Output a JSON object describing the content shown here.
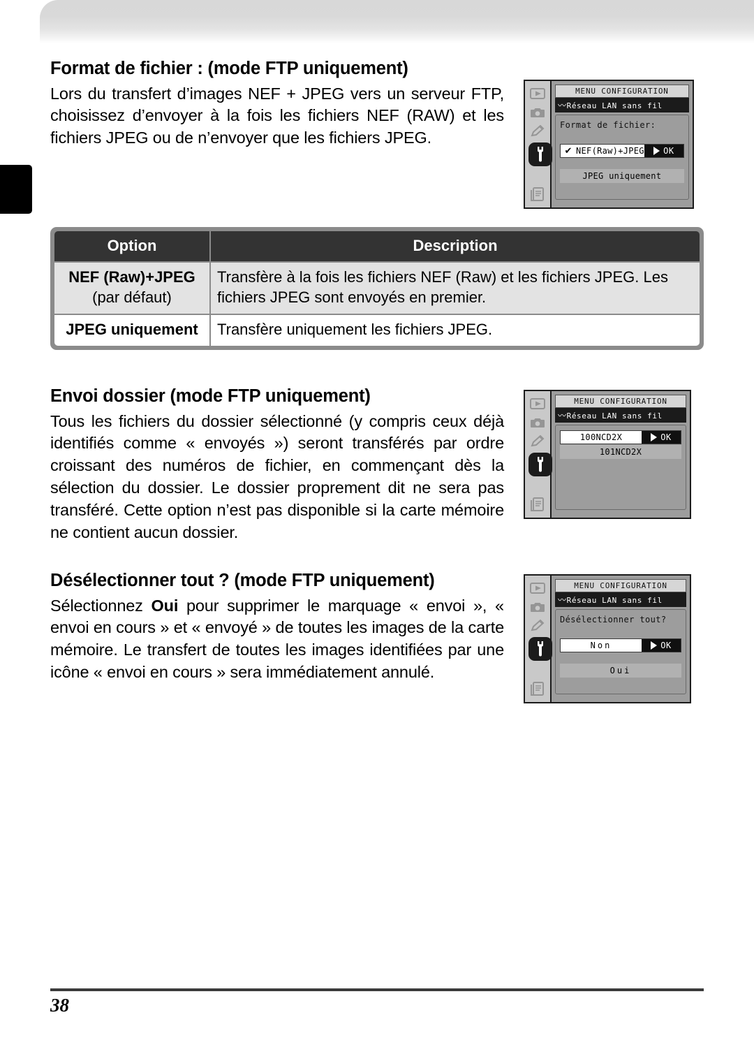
{
  "page": {
    "number": "38",
    "language": "fr"
  },
  "sections": [
    {
      "id": "format-fichier",
      "heading": "Format de fichier : (mode FTP uniquement)",
      "body": "Lors du transfert d’images NEF + JPEG vers un serveur FTP, choisissez d’envoyer à la fois les fichiers NEF (RAW) et les fichiers JPEG ou de n’envoyer que les fichiers JPEG."
    },
    {
      "id": "envoi-dossier",
      "heading": "Envoi dossier (mode FTP uniquement)",
      "body": "Tous les fichiers du dossier sélectionné (y compris ceux déjà identifiés comme « envoyés ») seront transférés par ordre croissant des numéros de fichier, en commençant dès la sélection du dossier. Le dossier proprement dit ne sera pas transféré. Cette option n’est pas disponible si la carte mémoire ne contient aucun dossier."
    },
    {
      "id": "deselectionner-tout",
      "heading": "Désélectionner tout ? (mode FTP uniquement)",
      "body_prefix": "Sélectionnez ",
      "body_bold": "Oui",
      "body_suffix": " pour supprimer le marquage « envoi », « envoi en cours » et « envoyé » de toutes les images de la carte mémoire. Le transfert de toutes les images identifiées par une icône « envoi en cours » sera immédiatement annulé."
    }
  ],
  "options_table": {
    "headers": {
      "option": "Option",
      "description": "Description"
    },
    "rows": [
      {
        "option": "NEF (Raw)+JPEG",
        "option_sub": "(par défaut)",
        "description": "Transfère à la fois les fichiers NEF (Raw) et les fichiers JPEG. Les fichiers JPEG sont envoyés en premier."
      },
      {
        "option": "JPEG uniquement",
        "option_sub": "",
        "description": "Transfère uniquement les fichiers JPEG."
      }
    ]
  },
  "lcd_screens": [
    {
      "id": "lcd-format-fichier",
      "title": "MENU CONFIGURATION",
      "subtitle": "Réseau LAN sans fil",
      "prompt": "Format de fichier:",
      "selected_option": "NEF(Raw)+JPEG",
      "ok_label": "OK",
      "check_glyph": "✔",
      "other_option": "JPEG uniquement",
      "rail_icons": [
        "playback-icon",
        "camera-icon",
        "pencil-icon",
        "wrench-icon",
        "recent-settings-icon"
      ]
    },
    {
      "id": "lcd-envoi-dossier",
      "title": "MENU CONFIGURATION",
      "subtitle": "Réseau LAN sans fil",
      "prompt": "",
      "selected_option": "100NCD2X",
      "ok_label": "OK",
      "check_glyph": "",
      "other_option": "101NCD2X",
      "rail_icons": [
        "playback-icon",
        "camera-icon",
        "pencil-icon",
        "wrench-icon",
        "recent-settings-icon"
      ]
    },
    {
      "id": "lcd-deselectionner-tout",
      "title": "MENU CONFIGURATION",
      "subtitle": "Réseau LAN sans fil",
      "prompt": "Désélectionner tout?",
      "selected_option": "Non",
      "ok_label": "OK",
      "check_glyph": "",
      "other_option": "Oui",
      "rail_icons": [
        "playback-icon",
        "camera-icon",
        "pencil-icon",
        "wrench-icon",
        "recent-settings-icon"
      ]
    }
  ],
  "colors": {
    "table_header_bg": "#333333",
    "table_frame": "#8b8b8b",
    "row_shaded_bg": "#e3e3e3",
    "lcd_screen_bg": "#9d9d9d",
    "lcd_dark": "#1b1b1b",
    "chapter_tab": "#000000"
  }
}
